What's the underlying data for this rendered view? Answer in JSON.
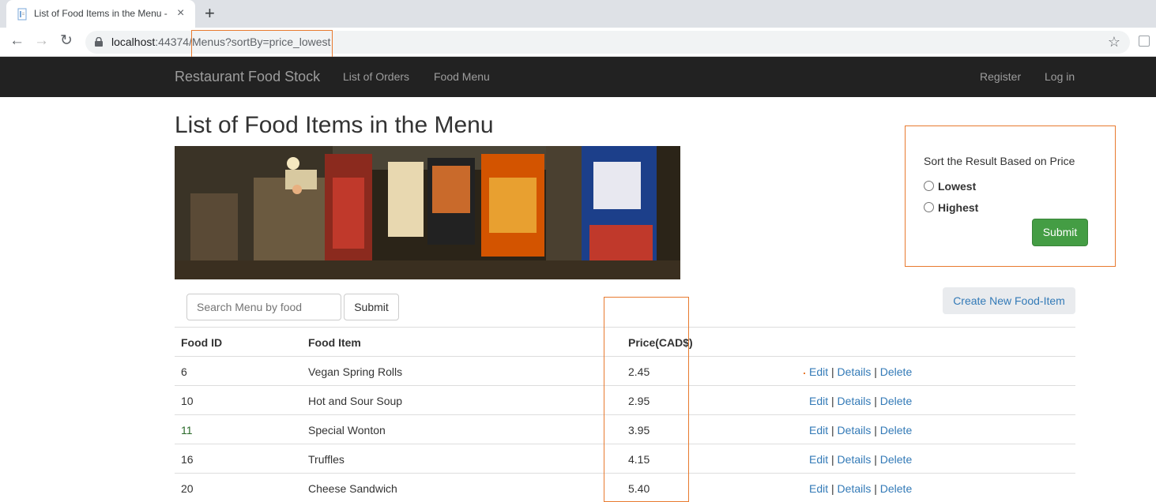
{
  "browser": {
    "tab_title": "List of Food Items in the Menu - ",
    "tab_close": "×",
    "new_tab": "+",
    "back": "←",
    "forward": "→",
    "reload": "↻",
    "url_host": "localhost",
    "url_rest": ":44374/Menus?sortBy=price_lowest",
    "star": "☆"
  },
  "navbar": {
    "brand": "Restaurant Food Stock",
    "links": [
      "List of Orders",
      "Food Menu"
    ],
    "right_links": [
      "Register",
      "Log in"
    ]
  },
  "page": {
    "title": "List of Food Items in the Menu"
  },
  "sort": {
    "label": "Sort the Result Based on Price",
    "options": [
      "Lowest",
      "Highest"
    ],
    "submit": "Submit"
  },
  "search": {
    "placeholder": "Search Menu by food",
    "submit": "Submit"
  },
  "create_button": "Create New Food-Item",
  "table": {
    "headers": [
      "Food ID",
      "Food Item",
      "Price(CAD$)"
    ],
    "action_labels": [
      "Edit",
      "Details",
      "Delete"
    ],
    "rows": [
      {
        "id": "6",
        "item": "Vegan Spring Rolls",
        "price": "2.45"
      },
      {
        "id": "10",
        "item": "Hot and Sour Soup",
        "price": "2.95"
      },
      {
        "id": "11",
        "item": "Special Wonton",
        "price": "3.95"
      },
      {
        "id": "16",
        "item": "Truffles",
        "price": "4.15"
      },
      {
        "id": "20",
        "item": "Cheese Sandwich",
        "price": "5.40"
      }
    ]
  },
  "colors": {
    "navbar_bg": "#222222",
    "submit_green": "#449d44",
    "link_blue": "#337ab7",
    "highlight_orange": "#e87a2f"
  }
}
